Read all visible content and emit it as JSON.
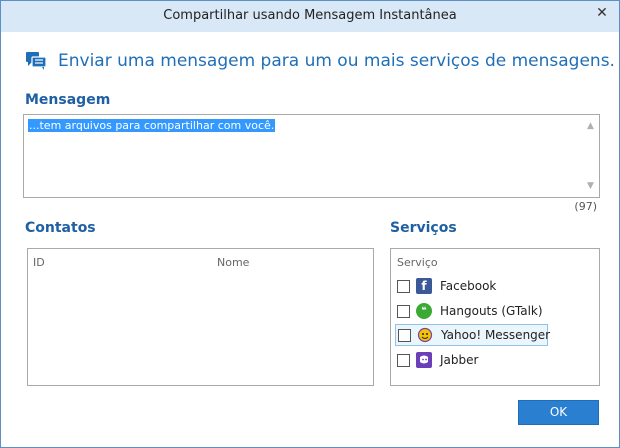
{
  "window": {
    "title": "Compartilhar usando Mensagem Instantânea",
    "close_glyph": "✕"
  },
  "headline": {
    "text": "Enviar uma mensagem para um ou mais serviços de mensagens.",
    "icon": "chat-bubbles-icon",
    "color": "#1f6fb8"
  },
  "message": {
    "label": "Mensagem",
    "value": "...tem arquivos para compartilhar com você.",
    "char_count": "(97)"
  },
  "contacts": {
    "label": "Contatos",
    "columns": [
      "ID",
      "Nome"
    ],
    "rows": []
  },
  "services": {
    "label": "Serviços",
    "column": "Serviço",
    "items": [
      {
        "label": "Facebook",
        "icon": "facebook-icon",
        "checked": false,
        "color": "#3b5998"
      },
      {
        "label": "Hangouts (GTalk)",
        "icon": "hangouts-icon",
        "checked": false,
        "color": "#3aaa35"
      },
      {
        "label": "Yahoo! Messenger",
        "icon": "yahoo-messenger-icon",
        "checked": false,
        "color": "#f5c400",
        "focused": true
      },
      {
        "label": "Jabber",
        "icon": "jabber-icon",
        "checked": false,
        "color": "#6a3fb8"
      }
    ]
  },
  "buttons": {
    "ok": "OK"
  }
}
